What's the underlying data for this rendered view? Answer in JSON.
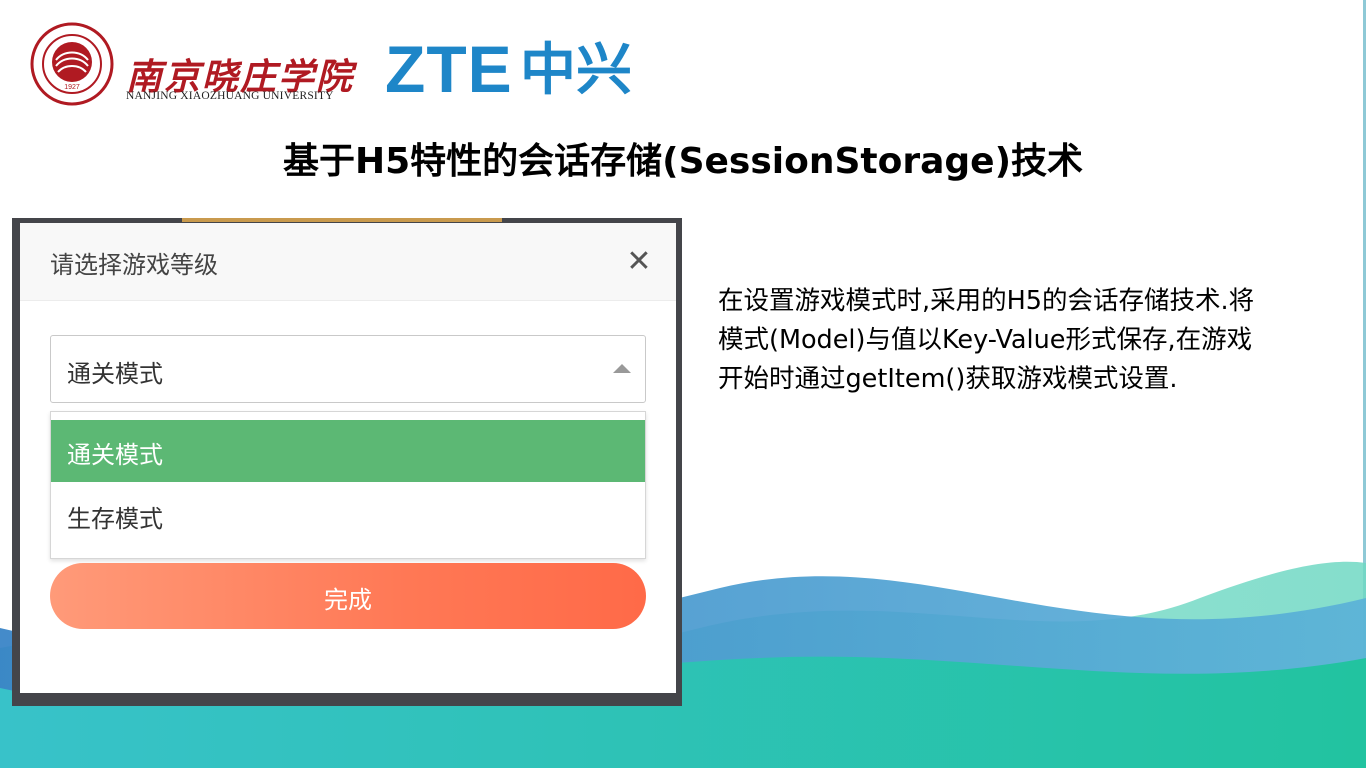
{
  "header": {
    "university_name_cn": "南京晓庄学院",
    "university_name_en": "NANJING XIAOZHUANG UNIVERSITY",
    "seal_year": "1927",
    "partner_logo_text": "ZTE",
    "partner_logo_cn": "中兴"
  },
  "slide": {
    "title": "基于H5特性的会话存储(SessionStorage)技术",
    "description": "在设置游戏模式时,采用的H5的会话存储技术.将模式(Model)与值以Key-Value形式保存,在游戏开始时通过getItem()获取游戏模式设置."
  },
  "modal": {
    "title": "请选择游戏等级",
    "close_icon": "close-icon",
    "select": {
      "value": "通关模式",
      "options": [
        "通关模式",
        "生存模式"
      ],
      "selected_index": 0
    },
    "done_label": "完成"
  },
  "colors": {
    "title_text": "#000000",
    "logo_blue": "#1e86c8",
    "seal_red": "#b01a22",
    "selected_option_bg": "#5cb874",
    "done_button_from": "#ff9a79",
    "done_button_to": "#ff6a48",
    "wave_teal": "#2bbfa8",
    "wave_blue": "#3a8fc7"
  }
}
